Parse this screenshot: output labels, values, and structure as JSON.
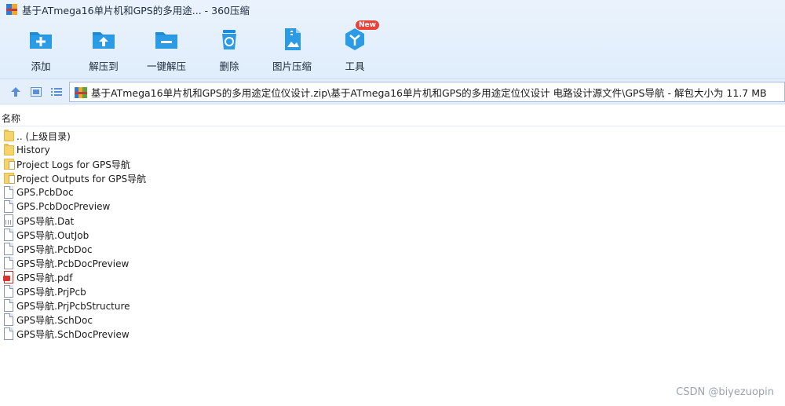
{
  "window": {
    "title": "基于ATmega16单片机和GPS的多用途... - 360压缩"
  },
  "toolbar": {
    "buttons": [
      {
        "label": "添加",
        "icon": "add-icon"
      },
      {
        "label": "解压到",
        "icon": "extract-to-icon"
      },
      {
        "label": "一键解压",
        "icon": "one-click-extract-icon"
      },
      {
        "label": "删除",
        "icon": "delete-icon"
      },
      {
        "label": "图片压缩",
        "icon": "image-compress-icon"
      },
      {
        "label": "工具",
        "icon": "tools-icon",
        "badge": "New"
      }
    ]
  },
  "addressbar": {
    "path": "基于ATmega16单片机和GPS的多用途定位仪设计.zip\\基于ATmega16单片机和GPS的多用途定位仪设计 电路设计源文件\\GPS导航 - 解包大小为 11.7 MB"
  },
  "filelist": {
    "column_name": "名称",
    "items": [
      {
        "name": ".. (上级目录)",
        "type": "folder"
      },
      {
        "name": "History",
        "type": "folder"
      },
      {
        "name": "Project Logs for GPS导航",
        "type": "folder-doc"
      },
      {
        "name": "Project Outputs for GPS导航",
        "type": "folder-doc"
      },
      {
        "name": "GPS.PcbDoc",
        "type": "file"
      },
      {
        "name": "GPS.PcbDocPreview",
        "type": "file"
      },
      {
        "name": "GPS导航.Dat",
        "type": "dat"
      },
      {
        "name": "GPS导航.OutJob",
        "type": "file"
      },
      {
        "name": "GPS导航.PcbDoc",
        "type": "file"
      },
      {
        "name": "GPS导航.PcbDocPreview",
        "type": "file"
      },
      {
        "name": "GPS导航.pdf",
        "type": "pdf"
      },
      {
        "name": "GPS导航.PrjPcb",
        "type": "file"
      },
      {
        "name": "GPS导航.PrjPcbStructure",
        "type": "file"
      },
      {
        "name": "GPS导航.SchDoc",
        "type": "file"
      },
      {
        "name": "GPS导航.SchDocPreview",
        "type": "file"
      }
    ]
  },
  "watermark": "CSDN @biyezuopin",
  "colors": {
    "accent": "#1a8cd8",
    "header_bg": "#e4effb",
    "badge": "#e8423b"
  }
}
